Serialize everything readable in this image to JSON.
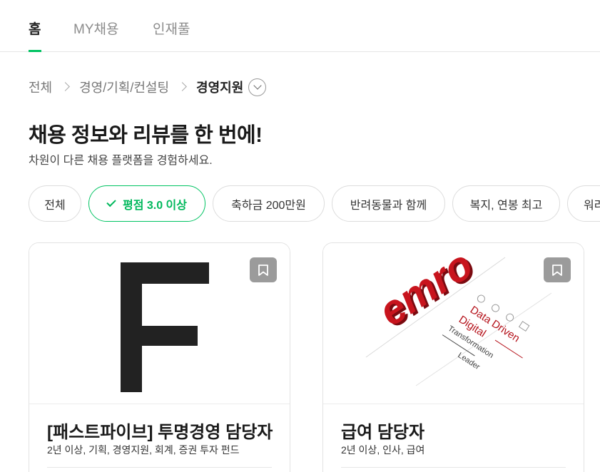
{
  "tabs": [
    {
      "label": "홈",
      "active": true
    },
    {
      "label": "MY채용",
      "active": false
    },
    {
      "label": "인재풀",
      "active": false
    }
  ],
  "breadcrumb": {
    "items": [
      "전체",
      "경영/기획/컨설팅",
      "경영지원"
    ]
  },
  "headline": "채용 정보와 리뷰를 한 번에!",
  "subline": "차원이 다른 채용 플랫폼을 경험하세요.",
  "filters": [
    {
      "label": "전체",
      "active": false
    },
    {
      "label": "평점 3.0 이상",
      "active": true
    },
    {
      "label": "축하금 200만원",
      "active": false
    },
    {
      "label": "반려동물과 함께",
      "active": false
    },
    {
      "label": "복지, 연봉 최고",
      "active": false
    },
    {
      "label": "워라",
      "active": false
    }
  ],
  "cards": [
    {
      "title": "[패스트파이브] 투명경영 담당자",
      "tags": "2년 이상, 기획, 경영지원, 회계, 증권 투자 펀드",
      "logo_letter": "F"
    },
    {
      "title": "급여 담당자",
      "tags": "2년 이상, 인사, 급여",
      "logo_text": "emro",
      "logo_lines": [
        "Data Driven",
        "Digital",
        "Transformation",
        "Leader"
      ]
    }
  ],
  "colors": {
    "accent": "#00c362",
    "emro_red": "#b5121b",
    "bookmark": "#9b9b9b"
  },
  "icons": {
    "bookmark": "bookmark-icon",
    "check": "check-icon",
    "chevron": "chevron-right-icon",
    "dropdown": "chevron-down-icon"
  }
}
